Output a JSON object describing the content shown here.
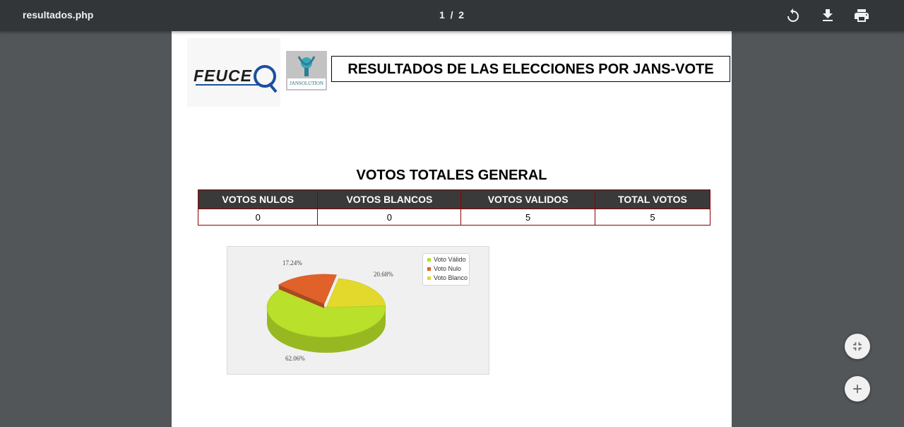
{
  "viewer": {
    "title": "resultados.php",
    "page_current": "1",
    "page_separator": "/",
    "page_total": "2",
    "icons": [
      "rotate-icon",
      "download-icon",
      "print-icon",
      "fit-page-icon",
      "zoom-in-icon"
    ]
  },
  "report": {
    "logo_feuce_text": "FEUCE",
    "logo_jans_text": "JANSOLUTION",
    "title": "RESULTADOS DE LAS ELECCIONES POR JANS-VOTE",
    "section_title": "VOTOS TOTALES GENERAL",
    "table": {
      "headers": [
        "VOTOS NULOS",
        "VOTOS BLANCOS",
        "VOTOS VALIDOS",
        "TOTAL VOTOS"
      ],
      "values": [
        "0",
        "0",
        "5",
        "5"
      ]
    }
  },
  "chart_data": {
    "type": "pie",
    "title": "",
    "legend_placement": "top-right",
    "slices": [
      {
        "label": "Voto Válido",
        "value": 62.06,
        "display": "62.06%",
        "color": "#b9e02a"
      },
      {
        "label": "Voto Nulo",
        "value": 17.24,
        "display": "17.24%",
        "color": "#e0622a"
      },
      {
        "label": "Voto Blanco",
        "value": 20.68,
        "display": "20.68%",
        "color": "#e3d92c"
      }
    ]
  }
}
